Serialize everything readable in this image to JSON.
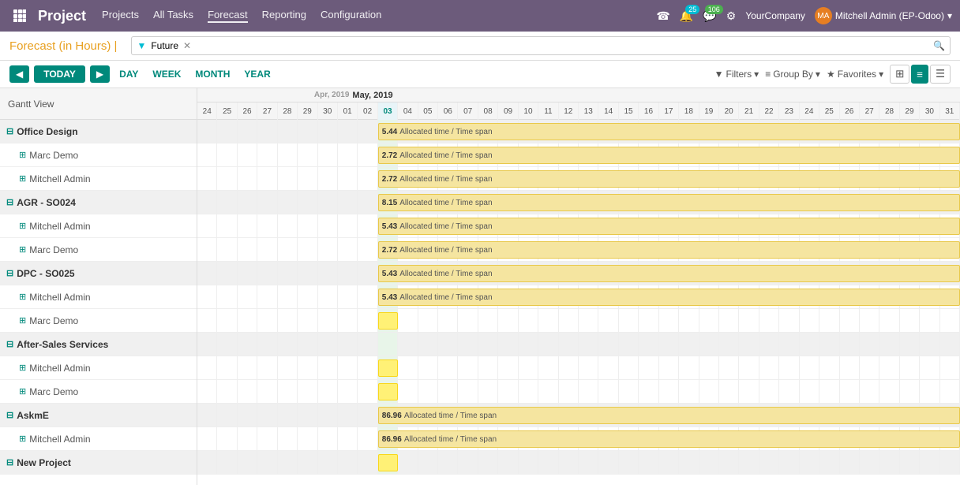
{
  "navbar": {
    "app_grid_label": "Apps",
    "title": "Project",
    "menu_items": [
      "Projects",
      "All Tasks",
      "Forecast",
      "Reporting",
      "Configuration"
    ],
    "phone_icon": "☎",
    "bell_icon": "🔔",
    "activity_badge": "25",
    "message_badge": "106",
    "star_icon": "★",
    "company": "YourCompany",
    "user": "Mitchell Admin (EP-Odoo)"
  },
  "sub_toolbar": {
    "forecast_label": "Forecast (in Hours)",
    "filter_tag": "Future",
    "search_placeholder": "",
    "search_icon": "🔍"
  },
  "nav_toolbar": {
    "prev_label": "◀",
    "today_label": "TODAY",
    "next_label": "▶",
    "day_label": "DAY",
    "week_label": "WEEK",
    "month_label": "MONTH",
    "year_label": "YEAR",
    "filters_label": "Filters",
    "group_by_label": "Group By",
    "favorites_label": "Favorites"
  },
  "gantt": {
    "header_label": "Gantt View",
    "month_label": "May, 2019",
    "apr_days": [
      "24",
      "25",
      "26",
      "27",
      "28",
      "29",
      "30"
    ],
    "may_days": [
      "01",
      "02",
      "03",
      "04",
      "05",
      "06",
      "07",
      "08",
      "09",
      "10",
      "11",
      "12",
      "13",
      "14",
      "15",
      "16",
      "17",
      "18",
      "19",
      "20",
      "21",
      "22",
      "23",
      "24",
      "25",
      "26",
      "27",
      "28",
      "29",
      "30",
      "31"
    ],
    "today_day": "03",
    "rows": [
      {
        "id": "office-design",
        "type": "group",
        "label": "Office Design",
        "has_bar": true,
        "bar_value": "5.44",
        "bar_text": "Allocated time / Time span"
      },
      {
        "id": "marc-demo-1",
        "type": "child",
        "label": "Marc Demo",
        "has_bar": true,
        "bar_value": "2.72",
        "bar_text": "Allocated time / Time span"
      },
      {
        "id": "mitchell-admin-1",
        "type": "child",
        "label": "Mitchell Admin",
        "has_bar": true,
        "bar_value": "2.72",
        "bar_text": "Allocated time / Time span"
      },
      {
        "id": "agr-so024",
        "type": "group",
        "label": "AGR - SO024",
        "has_bar": true,
        "bar_value": "8.15",
        "bar_text": "Allocated time / Time span"
      },
      {
        "id": "mitchell-admin-2",
        "type": "child",
        "label": "Mitchell Admin",
        "has_bar": true,
        "bar_value": "5.43",
        "bar_text": "Allocated time / Time span"
      },
      {
        "id": "marc-demo-2",
        "type": "child",
        "label": "Marc Demo",
        "has_bar": true,
        "bar_value": "2.72",
        "bar_text": "Allocated time / Time span"
      },
      {
        "id": "dpc-so025",
        "type": "group",
        "label": "DPC - SO025",
        "has_bar": true,
        "bar_value": "5.43",
        "bar_text": "Allocated time / Time span"
      },
      {
        "id": "mitchell-admin-3",
        "type": "child",
        "label": "Mitchell Admin",
        "has_bar": true,
        "bar_value": "5.43",
        "bar_text": "Allocated time / Time span"
      },
      {
        "id": "marc-demo-3",
        "type": "child",
        "label": "Marc Demo",
        "has_bar": false,
        "bar_value": "",
        "bar_text": "",
        "has_yellow_bar": true
      },
      {
        "id": "after-sales",
        "type": "group",
        "label": "After-Sales Services",
        "has_bar": false,
        "bar_value": "",
        "bar_text": ""
      },
      {
        "id": "mitchell-admin-4",
        "type": "child",
        "label": "Mitchell Admin",
        "has_bar": false,
        "bar_value": "",
        "bar_text": "",
        "has_yellow_bar": true
      },
      {
        "id": "marc-demo-4",
        "type": "child",
        "label": "Marc Demo",
        "has_bar": false,
        "bar_value": "",
        "bar_text": "",
        "has_yellow_bar": true
      },
      {
        "id": "askme",
        "type": "group",
        "label": "AskmE",
        "has_bar": true,
        "bar_value": "86.96",
        "bar_text": "Allocated time / Time span"
      },
      {
        "id": "mitchell-admin-5",
        "type": "child",
        "label": "Mitchell Admin",
        "has_bar": true,
        "bar_value": "86.96",
        "bar_text": "Allocated time / Time span"
      },
      {
        "id": "new-project",
        "type": "group",
        "label": "New Project",
        "has_bar": false,
        "bar_value": "",
        "bar_text": "",
        "has_yellow_bar": true
      }
    ]
  }
}
